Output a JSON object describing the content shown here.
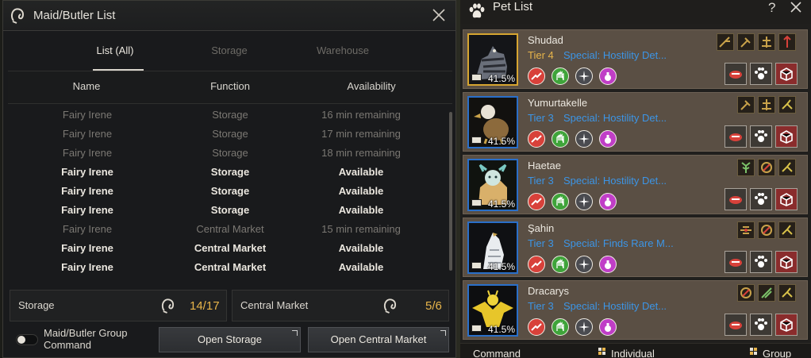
{
  "maid_panel": {
    "title": "Maid/Butler List",
    "tabs": [
      {
        "label": "List (All)",
        "active": true
      },
      {
        "label": "Storage",
        "active": false
      },
      {
        "label": "Warehouse",
        "active": false
      }
    ],
    "columns": [
      "Name",
      "Function",
      "Availability"
    ],
    "rows": [
      {
        "name": "Fairy Irene",
        "function": "Storage",
        "availability": "16 min remaining",
        "available": false
      },
      {
        "name": "Fairy Irene",
        "function": "Storage",
        "availability": "17 min remaining",
        "available": false
      },
      {
        "name": "Fairy Irene",
        "function": "Storage",
        "availability": "18 min remaining",
        "available": false
      },
      {
        "name": "Fairy Irene",
        "function": "Storage",
        "availability": "Available",
        "available": true
      },
      {
        "name": "Fairy Irene",
        "function": "Storage",
        "availability": "Available",
        "available": true
      },
      {
        "name": "Fairy Irene",
        "function": "Storage",
        "availability": "Available",
        "available": true
      },
      {
        "name": "Fairy Irene",
        "function": "Central Market",
        "availability": "15 min remaining",
        "available": false
      },
      {
        "name": "Fairy Irene",
        "function": "Central Market",
        "availability": "Available",
        "available": true
      },
      {
        "name": "Fairy Irene",
        "function": "Central Market",
        "availability": "Available",
        "available": true
      }
    ],
    "storage_summary": {
      "label": "Storage",
      "count": "14/17"
    },
    "market_summary": {
      "label": "Central Market",
      "count": "5/6"
    },
    "group_command_label": "Maid/Butler Group Command",
    "open_storage_label": "Open Storage",
    "open_market_label": "Open Central Market",
    "accent_color": "#e8b54a"
  },
  "pet_panel": {
    "title": "Pet List",
    "help_label": "?",
    "pets": [
      {
        "name": "Shudad",
        "tier": "Tier 4",
        "tier_color": "#e8b54a",
        "special": "Special: Hostility Det...",
        "hunger": "41.5%",
        "frame": "gold",
        "traits": [
          "Hostility",
          "Gathering",
          "Loot",
          "Detection"
        ]
      },
      {
        "name": "Yumurtakelle",
        "tier": "Tier 3",
        "tier_color": "#3c95e6",
        "special": "Special: Hostility Det...",
        "hunger": "41.5%",
        "frame": "blue",
        "traits": [
          "Gathering",
          "Loot",
          "Autoloot"
        ]
      },
      {
        "name": "Haetae",
        "tier": "Tier 3",
        "tier_color": "#3c95e6",
        "special": "Special: Hostility Det...",
        "hunger": "41.5%",
        "frame": "blue",
        "traits": [
          "Herb",
          "Hostility",
          "Autoloot"
        ]
      },
      {
        "name": "Şahin",
        "tier": "Tier 3",
        "tier_color": "#3c95e6",
        "special": "Special: Finds Rare M...",
        "hunger": "41.5%",
        "frame": "blue",
        "traits": [
          "Loot",
          "Hostility",
          "Autoloot"
        ]
      },
      {
        "name": "Dracarys",
        "tier": "Tier 3",
        "tier_color": "#3c95e6",
        "special": "Special: Hostility Det...",
        "hunger": "41.5%",
        "frame": "blue",
        "traits": [
          "Hostility",
          "Gathering",
          "Autoloot"
        ]
      }
    ],
    "footer": {
      "command_label": "Command",
      "individual_label": "Individual",
      "group_label": "Group"
    }
  }
}
